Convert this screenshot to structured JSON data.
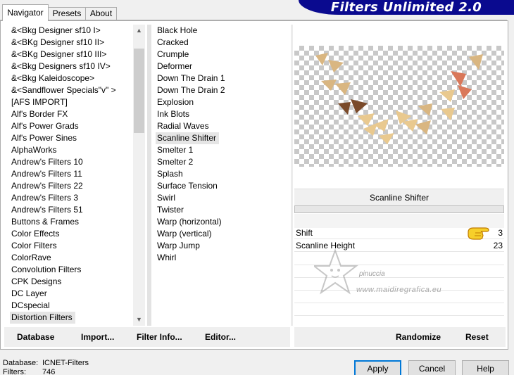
{
  "tabs": [
    "Navigator",
    "Presets",
    "About"
  ],
  "banner": "Filters Unlimited 2.0",
  "categories": [
    "&<Bkg Designer sf10 I>",
    "&<BKg Designer sf10 II>",
    "&<BKg Designer sf10 III>",
    "&<Bkg Designers sf10 IV>",
    "&<Bkg Kaleidoscope>",
    "&<Sandflower Specials\"v\" >",
    "[AFS IMPORT]",
    "Alf's Border FX",
    "Alf's Power Grads",
    "Alf's Power Sines",
    "AlphaWorks",
    "Andrew's Filters 10",
    "Andrew's Filters 11",
    "Andrew's Filters 22",
    "Andrew's Filters 3",
    "Andrew's Filters 51",
    "Buttons & Frames",
    "Color Effects",
    "Color Filters",
    "ColorRave",
    "Convolution Filters",
    "CPK Designs",
    "DC Layer",
    "DCspecial",
    "Distortion Filters"
  ],
  "selected_category": "Distortion Filters",
  "filters": [
    "Black Hole",
    "Cracked",
    "Crumple",
    "Deformer",
    "Down The Drain 1",
    "Down The Drain 2",
    "Explosion",
    "Ink Blots",
    "Radial Waves",
    "Scanline Shifter",
    "Smelter 1",
    "Smelter 2",
    "Splash",
    "Surface Tension",
    "Swirl",
    "Twister",
    "Warp (horizontal)",
    "Warp (vertical)",
    "Warp Jump",
    "Whirl"
  ],
  "selected_filter": "Scanline Shifter",
  "left_buttons": {
    "database": "Database",
    "import": "Import...",
    "filter_info": "Filter Info...",
    "editor": "Editor..."
  },
  "right_buttons": {
    "randomize": "Randomize",
    "reset": "Reset"
  },
  "filter_name_display": "Scanline Shifter",
  "progress": 0,
  "params": [
    {
      "label": "Shift",
      "value": "3"
    },
    {
      "label": "Scanline Height",
      "value": "23"
    }
  ],
  "watermark": {
    "line1": "pinuccia",
    "line2": "www.maidiregrafica.eu"
  },
  "status": {
    "database_label": "Database:",
    "database_value": "ICNET-Filters",
    "filters_label": "Filters:",
    "filters_value": "746"
  },
  "dialog_buttons": {
    "apply": "Apply",
    "cancel": "Cancel",
    "help": "Help"
  },
  "colors": {
    "banner_bg": "#0a0a8f",
    "triangle_tan": "#d9b681",
    "triangle_light": "#e9c98f",
    "triangle_brown": "#7a4a2a",
    "triangle_orange": "#d9785a",
    "focus_blue": "#0078d7"
  },
  "icons": {
    "hand": "pointing-hand-icon",
    "star": "star-watermark-icon",
    "scroll_up": "arrow-up-icon",
    "scroll_down": "arrow-down-icon"
  }
}
